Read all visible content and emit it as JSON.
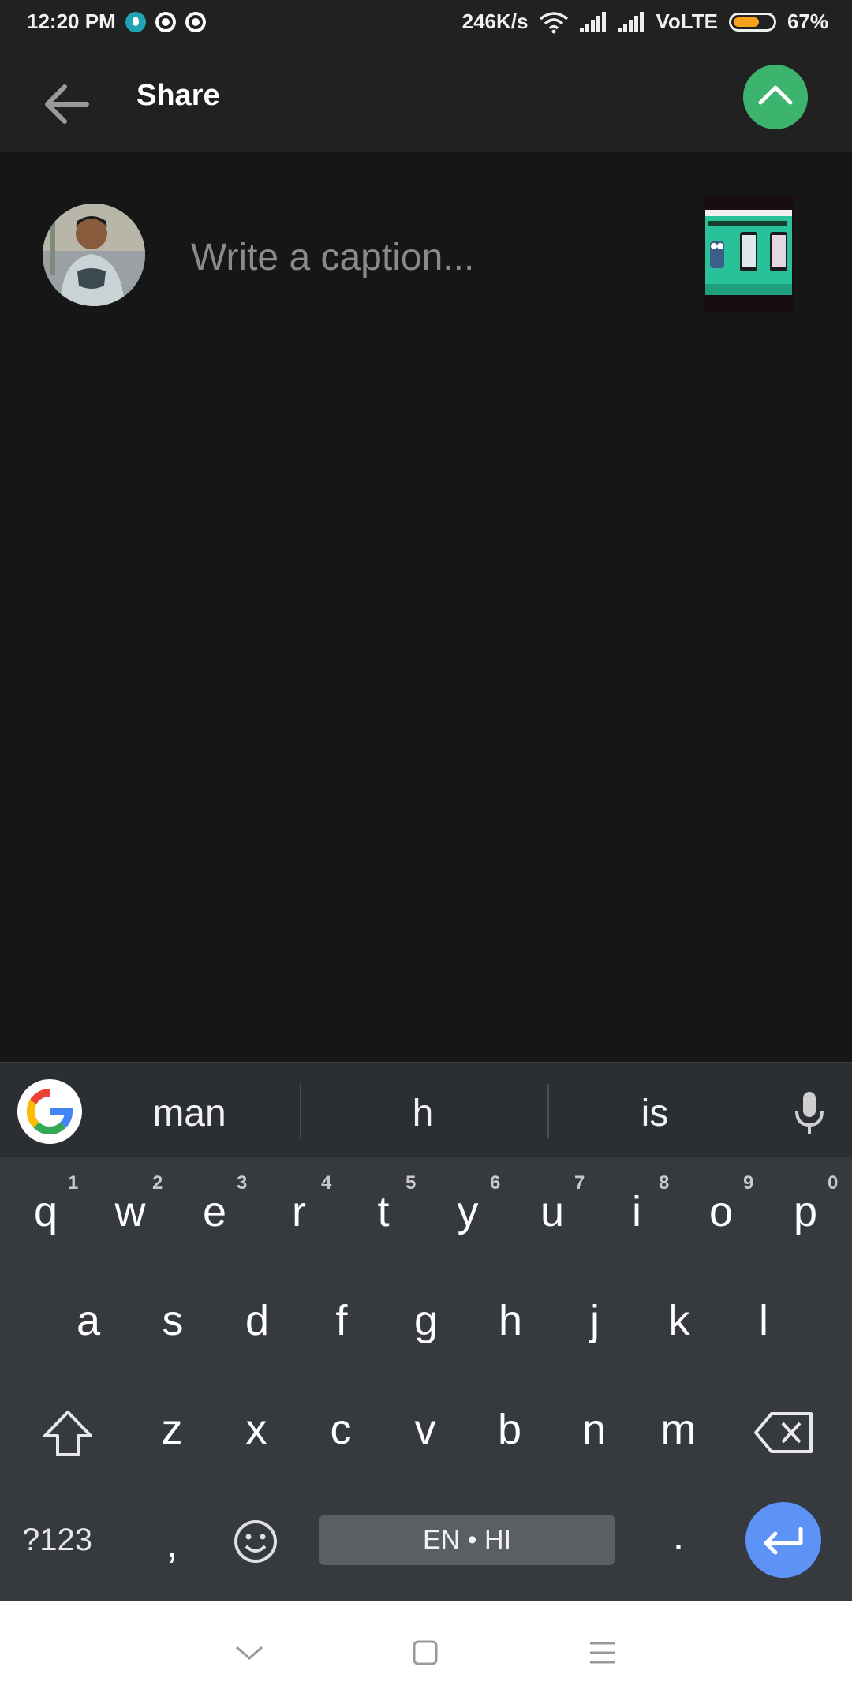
{
  "status_bar": {
    "time": "12:20 PM",
    "speed": "246K/s",
    "network": "VoLTE",
    "battery_percent": "67%",
    "battery_level": 0.67,
    "battery_color": "#f7a21b",
    "notification_icons": [
      "water-drop-icon",
      "whatsapp-icon",
      "whatsapp-icon"
    ]
  },
  "header": {
    "title": "Share",
    "back_icon": "arrow-left-icon",
    "action_icon": "chevron-up-icon",
    "action_color": "#3cb46e"
  },
  "composer": {
    "caption_placeholder": "Write a caption...",
    "caption_value": ""
  },
  "keyboard": {
    "suggestions": [
      "man",
      "h",
      "is"
    ],
    "row1": [
      "q",
      "w",
      "e",
      "r",
      "t",
      "y",
      "u",
      "i",
      "o",
      "p"
    ],
    "row1_hints": [
      "1",
      "2",
      "3",
      "4",
      "5",
      "6",
      "7",
      "8",
      "9",
      "0"
    ],
    "row2": [
      "a",
      "s",
      "d",
      "f",
      "g",
      "h",
      "j",
      "k",
      "l"
    ],
    "row3": [
      "z",
      "x",
      "c",
      "v",
      "b",
      "n",
      "m"
    ],
    "symbols_label": "?123",
    "comma": ",",
    "space_label": "EN • HI",
    "period": ".",
    "enter_color": "#5c93f5"
  }
}
